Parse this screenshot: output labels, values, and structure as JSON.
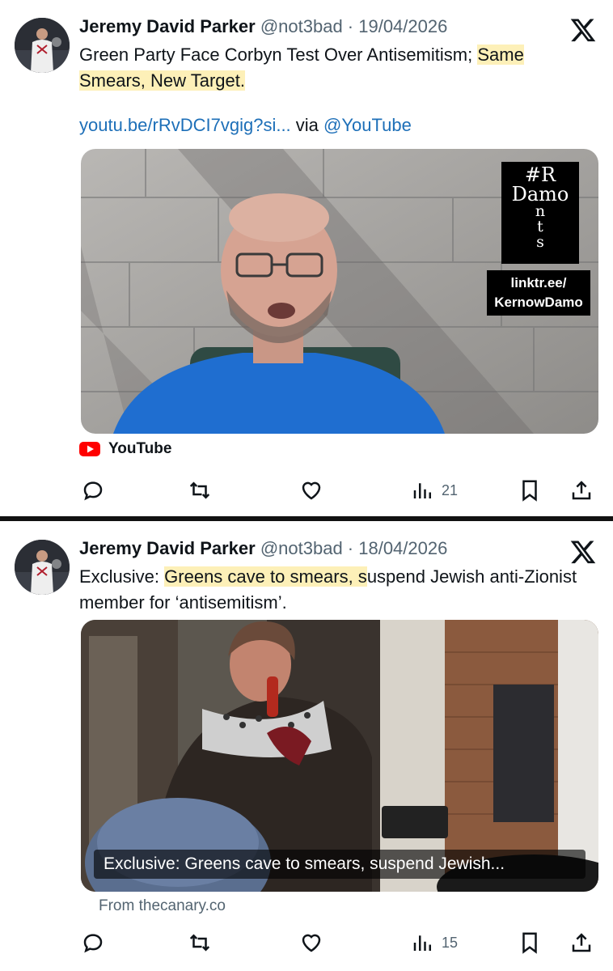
{
  "tweets": [
    {
      "author_name": "Jeremy David Parker",
      "handle_date": "@not3bad · 19/04/2026",
      "text_plain": "Green Party Face Corbyn Test Over Antisemitism; ",
      "text_highlight": "Same Smears, New Target.",
      "link": "youtu.be/rRvDCI7vgig?si...",
      "via": " via ",
      "via_handle": "@YouTube",
      "media_brand_lines": [
        "#R",
        "Damo",
        "n",
        "t",
        "s"
      ],
      "media_brand_link": "linktr.ee/ KernowDamo",
      "source": "YouTube",
      "views": "21"
    },
    {
      "author_name": "Jeremy David Parker",
      "handle_date": "@not3bad · 18/04/2026",
      "text_prefix": "Exclusive: ",
      "text_highlight": "Greens cave to smears, s",
      "text_suffix": "uspend Jewish anti-Zionist member for ‘antisemitism’.",
      "caption": "Exclusive: Greens cave to smears, suspend Jewish...",
      "from": "From thecanary.co",
      "views": "15"
    }
  ],
  "icons": {
    "platform": "x-logo-icon",
    "reply": "reply-icon",
    "repost": "repost-icon",
    "like": "heart-icon",
    "views": "views-bar-icon",
    "bookmark": "bookmark-icon",
    "share": "share-icon"
  },
  "colors": {
    "link": "#1d6fb8",
    "highlight": "#fdf0b8",
    "muted": "#536471",
    "youtube_red": "#ff0000"
  }
}
